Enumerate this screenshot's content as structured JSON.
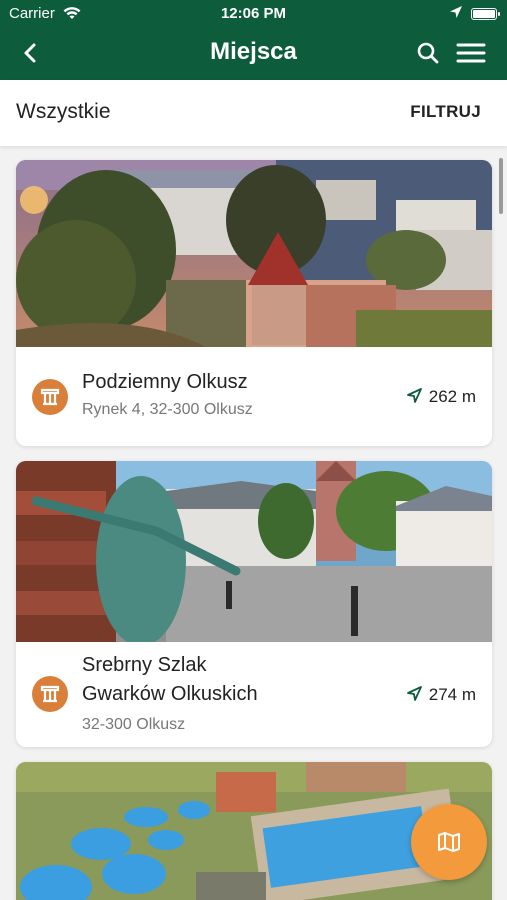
{
  "status_bar": {
    "carrier": "Carrier",
    "time": "12:06 PM"
  },
  "navbar": {
    "title": "Miejsca",
    "back_icon": "chevron-left-icon",
    "search_icon": "search-icon",
    "menu_icon": "hamburger-menu-icon"
  },
  "filter_bar": {
    "category": "Wszystkie",
    "filter_label": "FILTRUJ"
  },
  "places": [
    {
      "name": "Podziemny Olkusz",
      "address": "Rynek 4, 32-300 Olkusz",
      "distance": "262 m",
      "category_icon": "column-landmark-icon",
      "image": "aerial town view at dusk with red roof tower"
    },
    {
      "name": "Srebrny Szlak Gwarków Olkuskich",
      "name_line1": "Srebrny Szlak",
      "name_line2": "Gwarków Olkuskich",
      "address": "32-300 Olkusz",
      "distance": "274 m",
      "category_icon": "column-landmark-icon",
      "image": "green miner statue on town square"
    },
    {
      "image": "aerial view of outdoor swimming pools"
    }
  ],
  "fab": {
    "icon": "map-icon"
  },
  "colors": {
    "header_green": "#0d5c3c",
    "category_orange": "#d97f3a",
    "fab_orange": "#f29a3c",
    "distance_icon_green": "#0d5c3c"
  }
}
